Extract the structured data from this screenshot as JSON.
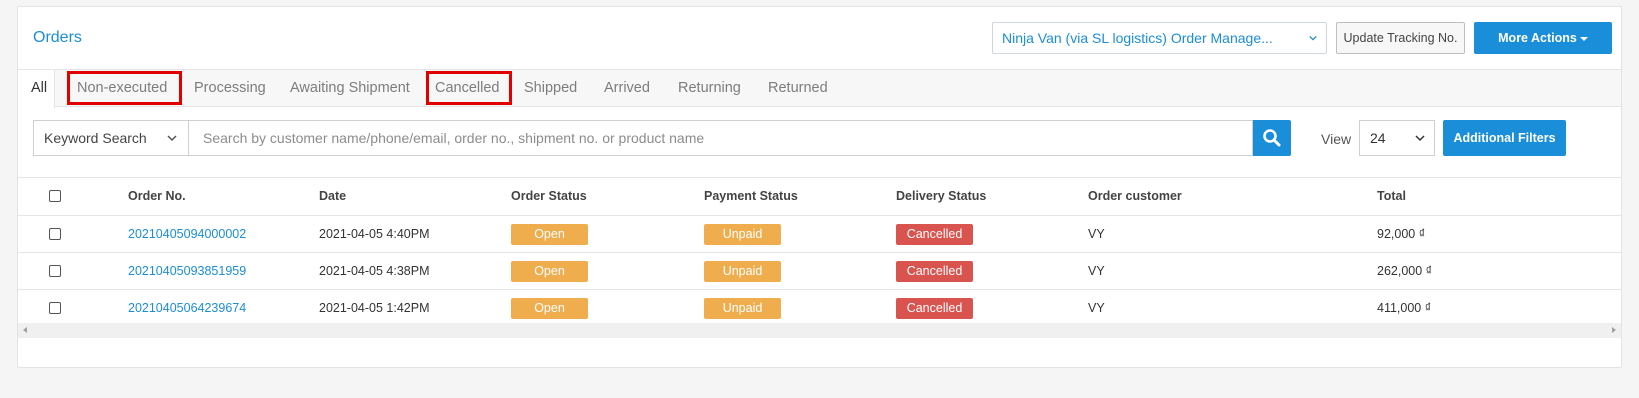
{
  "header": {
    "title": "Orders",
    "channel_select": "Ninja Van (via SL logistics) Order Manage...",
    "update_tracking_label": "Update Tracking No.",
    "more_actions_label": "More Actions"
  },
  "tabs": [
    {
      "label": "All",
      "active": true
    },
    {
      "label": "Non-executed",
      "highlighted": true
    },
    {
      "label": "Processing"
    },
    {
      "label": "Awaiting Shipment"
    },
    {
      "label": "Cancelled",
      "highlighted": true
    },
    {
      "label": "Shipped"
    },
    {
      "label": "Arrived"
    },
    {
      "label": "Returning"
    },
    {
      "label": "Returned"
    }
  ],
  "search": {
    "keyword_select": "Keyword Search",
    "placeholder": "Search by customer name/phone/email, order no., shipment no. or product name",
    "view_label": "View",
    "view_value": "24",
    "filters_label": "Additional Filters"
  },
  "table": {
    "columns": [
      "Order No.",
      "Date",
      "Order Status",
      "Payment Status",
      "Delivery Status",
      "Order customer",
      "Total"
    ],
    "rows": [
      {
        "order_no": "20210405094000002",
        "date": "2021-04-05 4:40PM",
        "order_status": "Open",
        "payment_status": "Unpaid",
        "delivery_status": "Cancelled",
        "customer": "VY",
        "total": "92,000 ₫"
      },
      {
        "order_no": "20210405093851959",
        "date": "2021-04-05 4:38PM",
        "order_status": "Open",
        "payment_status": "Unpaid",
        "delivery_status": "Cancelled",
        "customer": "VY",
        "total": "262,000 ₫"
      },
      {
        "order_no": "20210405064239674",
        "date": "2021-04-05 1:42PM",
        "order_status": "Open",
        "payment_status": "Unpaid",
        "delivery_status": "Cancelled",
        "customer": "VY",
        "total": "411,000 ₫"
      }
    ]
  },
  "colors": {
    "accent": "#1a8ed9",
    "open_badge": "#f0ad4e",
    "unpaid_badge": "#f0ad4e",
    "cancelled_badge": "#d9534f",
    "highlight": "#e00000"
  }
}
